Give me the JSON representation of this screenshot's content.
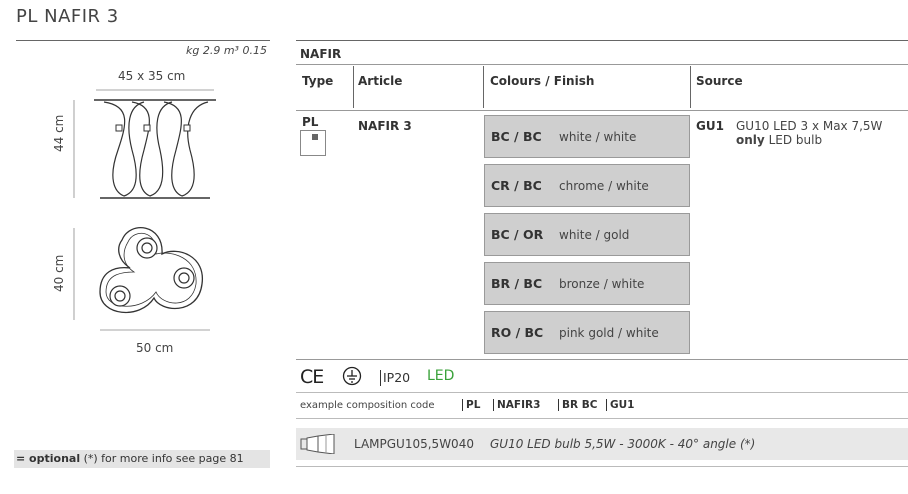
{
  "title": "PL NAFIR 3",
  "weight_volume": "kg 2.9 m³ 0.15",
  "dims": {
    "top_size": "45 x 35 cm",
    "height": "44 cm",
    "depth": "40 cm",
    "width": "50 cm"
  },
  "section": "NAFIR",
  "headers": {
    "type": "Type",
    "article": "Article",
    "colours": "Colours / Finish",
    "source": "Source"
  },
  "type_code": "PL",
  "article_code": "NAFIR 3",
  "finishes": [
    {
      "code": "BC / BC",
      "name": "white / white"
    },
    {
      "code": "CR / BC",
      "name": "chrome / white"
    },
    {
      "code": "BC / OR",
      "name": "white / gold"
    },
    {
      "code": "BR / BC",
      "name": "bronze / white"
    },
    {
      "code": "RO / BC",
      "name": "pink gold / white"
    }
  ],
  "source": {
    "code": "GU1",
    "desc": "GU10 LED 3 x Max 7,5W",
    "only": "only",
    "bulb": "LED bulb"
  },
  "certs": {
    "ce": "CE",
    "ip": "IP20",
    "led": "LED"
  },
  "composition": {
    "label": "example composition code",
    "parts": [
      "PL",
      "NAFIR3",
      "BR BC",
      "GU1"
    ]
  },
  "lamp": {
    "code": "LAMPGU105,5W040",
    "desc": "GU10 LED bulb 5,5W - 3000K - 40° angle (*)"
  },
  "optional": {
    "bold": "= optional",
    "rest": "(*) for more info see page 81"
  },
  "colors": {
    "led_green": "#3aa23a",
    "row_bg": "#cfcfcf"
  }
}
